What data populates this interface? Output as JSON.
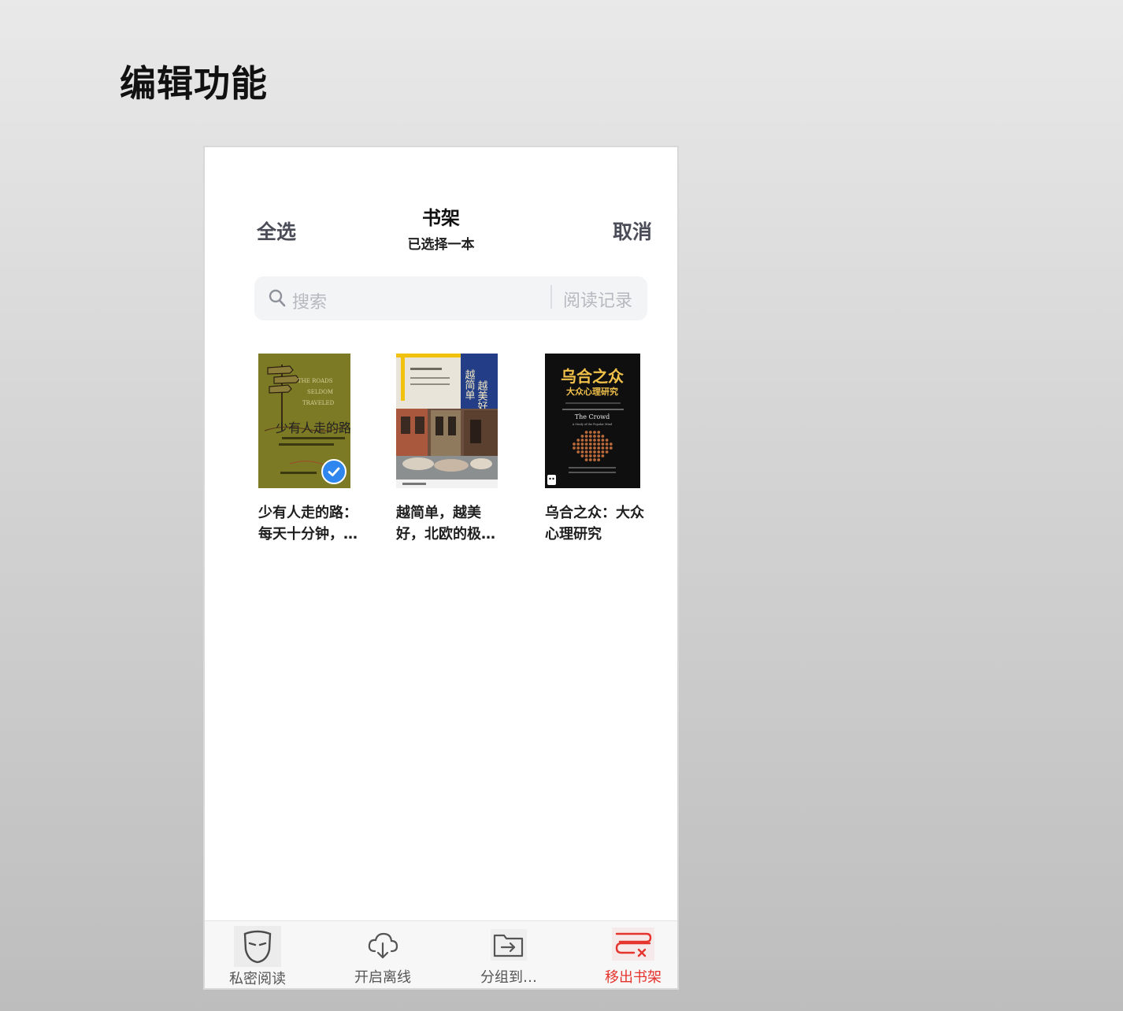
{
  "slide": {
    "title": "编辑功能"
  },
  "header": {
    "select_all": "全选",
    "title": "书架",
    "subtitle": "已选择一本",
    "cancel": "取消"
  },
  "search": {
    "placeholder": "搜索",
    "history_label": "阅读记录",
    "icon": "search-icon"
  },
  "books": [
    {
      "title_line1": "少有人走的路：",
      "title_line2": "每天十分钟，…",
      "selected": true,
      "cover_text": "少有人走的路",
      "cover_en_1": "THE ROADS",
      "cover_en_2": "SELDOM",
      "cover_en_3": "TRAVELED",
      "cover_color": "#7d7a26"
    },
    {
      "title_line1": "越简单，越美",
      "title_line2": "好，北欧的极…",
      "selected": false,
      "cover_text": "越简单，越美好",
      "cover_color": "#2a4a86"
    },
    {
      "title_line1": "乌合之众：大众",
      "title_line2": "心理研究",
      "selected": false,
      "cover_text_1": "乌合之众",
      "cover_text_2": "大众心理研究",
      "cover_en_1": "The Crowd",
      "cover_en_2": "A Study of the Popular Mind",
      "cover_color": "#111111"
    }
  ],
  "tabbar": [
    {
      "label": "私密阅读",
      "icon": "mask-icon",
      "active": false
    },
    {
      "label": "开启离线",
      "icon": "cloud-download-icon",
      "active": false
    },
    {
      "label": "分组到…",
      "icon": "folder-move-icon",
      "active": false
    },
    {
      "label": "移出书架",
      "icon": "remove-shelf-icon",
      "active": true
    }
  ],
  "colors": {
    "accent_red": "#e5342d",
    "check_blue": "#2f86ee"
  }
}
